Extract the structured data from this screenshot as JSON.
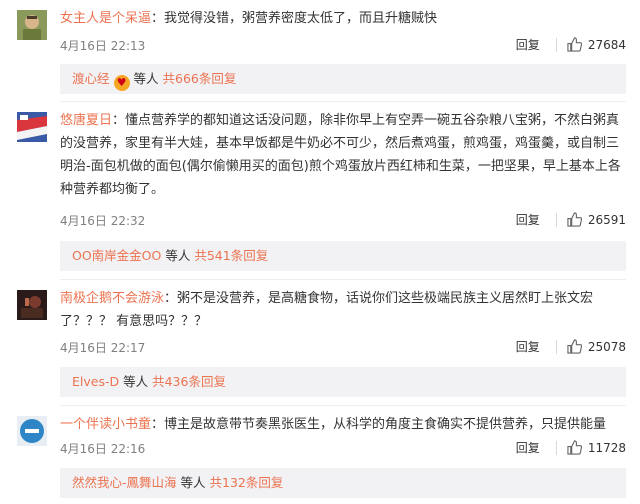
{
  "comments": [
    {
      "user": "女主人是个呆逼",
      "text": "：我觉得没错，粥营养密度太低了，而且升糖贼快",
      "time": "4月16日 22:13",
      "reply_label": "回复",
      "likes": "27684",
      "sub_user": "渡心经",
      "sub_etc": "等人",
      "sub_more": "共666条回复"
    },
    {
      "user": "悠唐夏日",
      "text": "：懂点营养学的都知道这话没问题，除非你早上有空弄一碗五谷杂粮八宝粥，不然白粥真的没营养，家里有半大娃，基本早饭都是牛奶必不可少，然后煮鸡蛋，煎鸡蛋，鸡蛋羹，或自制三明治-面包机做的面包(偶尔偷懒用买的面包)煎个鸡蛋放片西红柿和生菜，一把坚果，早上基本上各种营养都均衡了。",
      "time": "4月16日 22:32",
      "reply_label": "回复",
      "likes": "26591",
      "sub_user": "OO南岸金金OO",
      "sub_etc": "等人",
      "sub_more": "共541条回复"
    },
    {
      "user": "南极企鹅不会游泳",
      "text": "：粥不是没营养，是高糖食物，话说你们这些极端民族主义居然盯上张文宏了？？？ 有意思吗？？？",
      "time": "4月16日 22:17",
      "reply_label": "回复",
      "likes": "25078",
      "sub_user": "Elves-D",
      "sub_etc": "等人",
      "sub_more": "共436条回复"
    },
    {
      "user": "一个伴读小书童",
      "text": "：博主是故意带节奏黑张医生，从科学的角度主食确实不提供营养，只提供能量",
      "time": "4月16日 22:16",
      "reply_label": "回复",
      "likes": "11728",
      "sub_user": "然然我心-鳳舞山海",
      "sub_etc": "等人",
      "sub_more": "共132条回复"
    }
  ],
  "colors": {
    "username": "#eb7350",
    "meta": "#808080",
    "sub_bg": "#f2f2f5"
  },
  "icons": {
    "like": "thumbs-up-icon",
    "emoji": "heart-emoji-icon"
  }
}
